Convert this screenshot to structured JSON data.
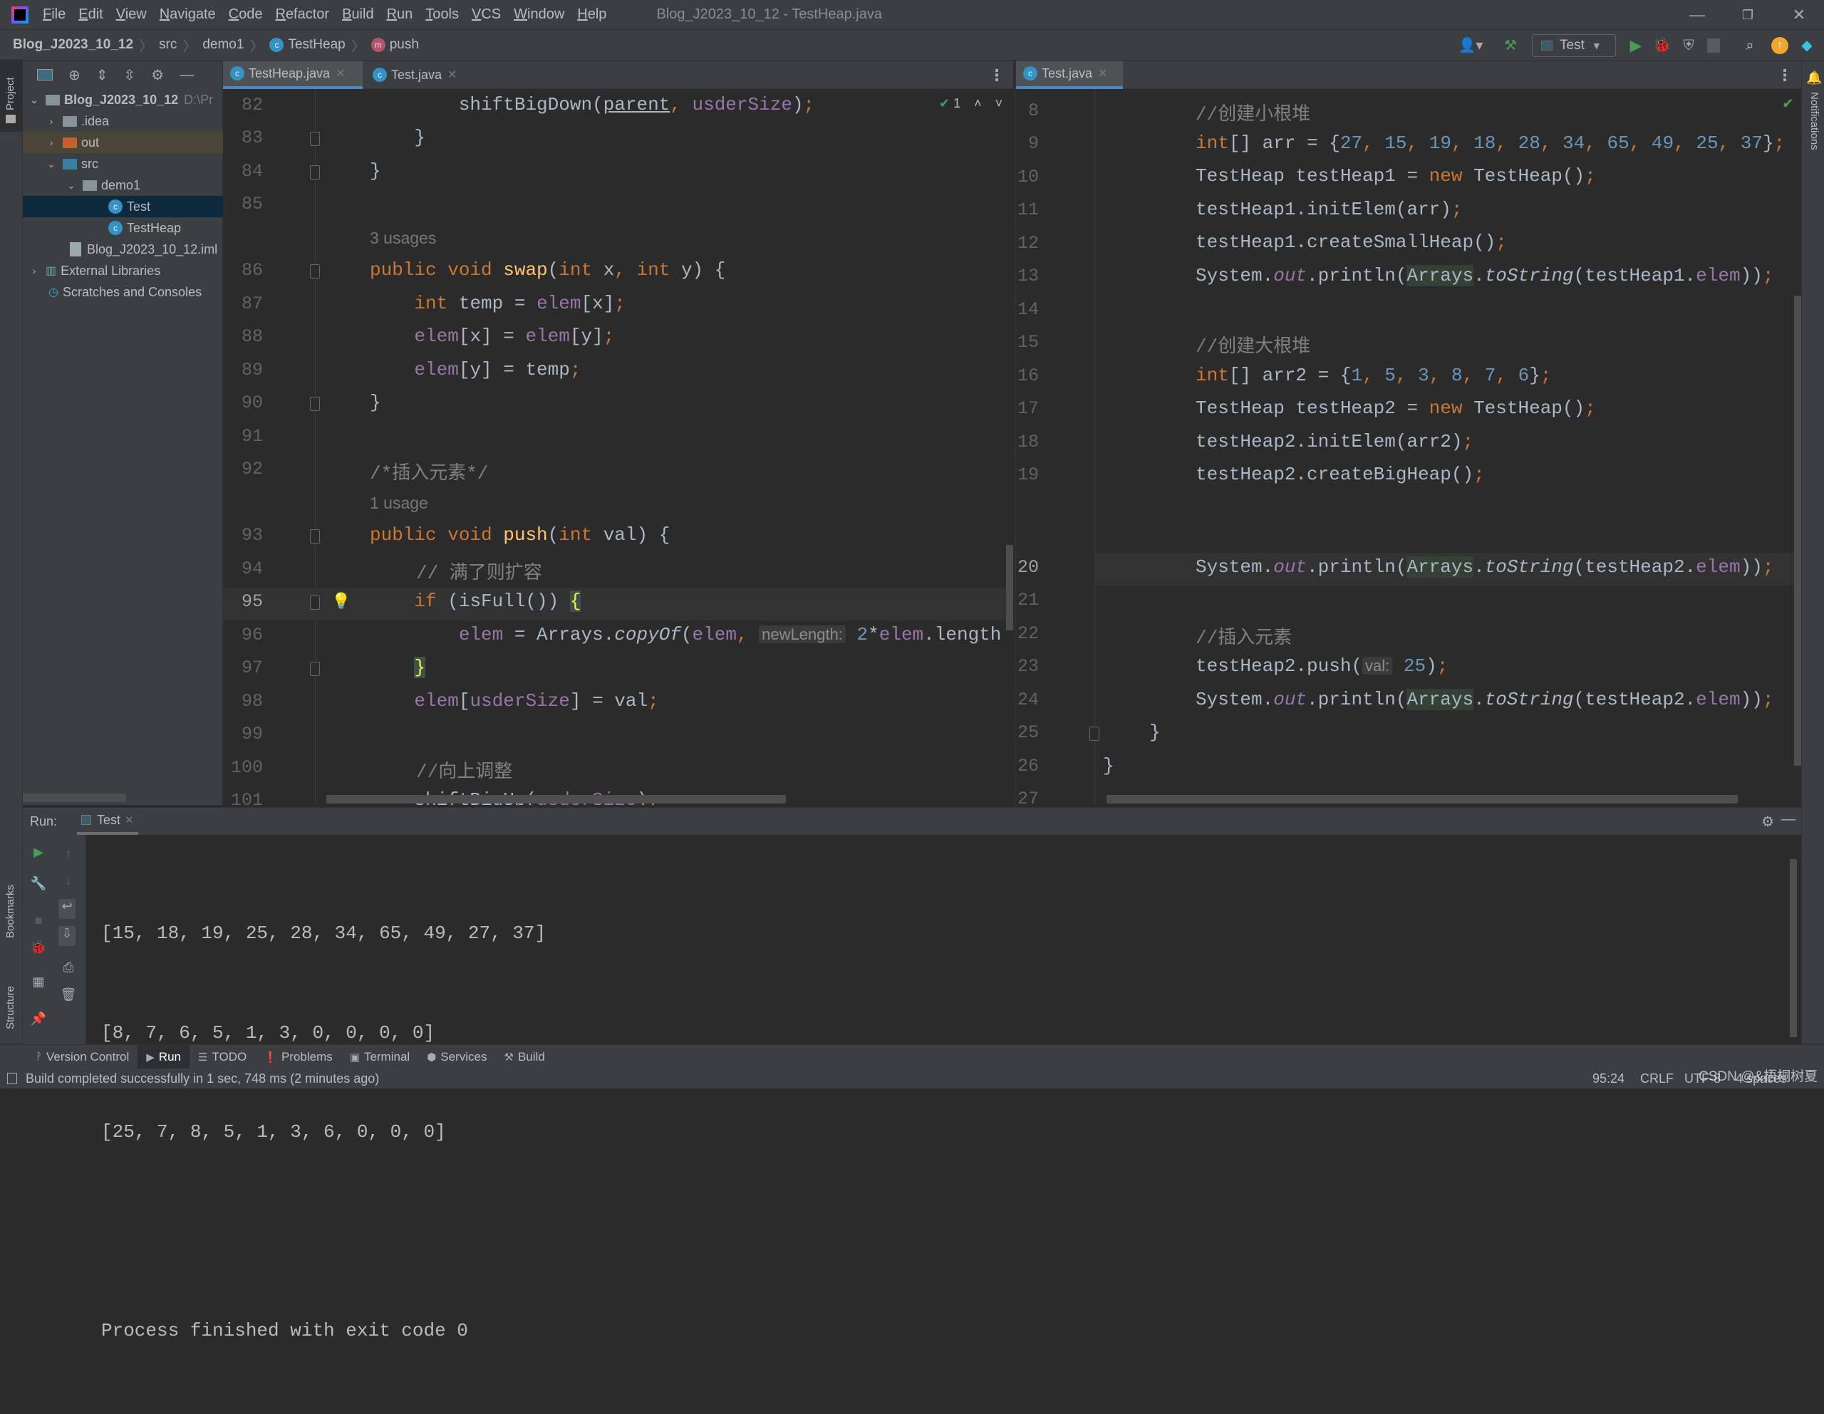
{
  "titlebar": {
    "menu": [
      "File",
      "Edit",
      "View",
      "Navigate",
      "Code",
      "Refactor",
      "Build",
      "Run",
      "Tools",
      "VCS",
      "Window",
      "Help"
    ],
    "window_title": "Blog_J2023_10_12 - TestHeap.java"
  },
  "navbar": {
    "breadcrumb": [
      "Blog_J2023_10_12",
      "src",
      "demo1",
      "TestHeap",
      "push"
    ],
    "run_config": "Test"
  },
  "left_stripe": {
    "project_label": "Project",
    "bookmarks_label": "Bookmarks",
    "structure_label": "Structure"
  },
  "right_stripe": {
    "notifications_label": "Notifications"
  },
  "project_tree": [
    {
      "label": "Blog_J2023_10_12",
      "suffix": "D:\\Pr",
      "depth": 0,
      "expanded": true,
      "type": "module"
    },
    {
      "label": ".idea",
      "depth": 1,
      "expanded": false,
      "type": "folder"
    },
    {
      "label": "out",
      "depth": 1,
      "expanded": false,
      "type": "folder-excluded"
    },
    {
      "label": "src",
      "depth": 1,
      "expanded": true,
      "type": "folder-source"
    },
    {
      "label": "demo1",
      "depth": 2,
      "expanded": true,
      "type": "package"
    },
    {
      "label": "Test",
      "depth": 3,
      "type": "class-main",
      "selected": true
    },
    {
      "label": "TestHeap",
      "depth": 3,
      "type": "class"
    },
    {
      "label": "Blog_J2023_10_12.iml",
      "depth": 1,
      "type": "iml"
    },
    {
      "label": "External Libraries",
      "depth": 0,
      "expanded": false,
      "type": "libraries"
    },
    {
      "label": "Scratches and Consoles",
      "depth": 0,
      "type": "scratches"
    }
  ],
  "editor_left": {
    "tabs": [
      {
        "label": "TestHeap.java",
        "active": true
      },
      {
        "label": "Test.java",
        "active": false
      }
    ],
    "inspection": "1",
    "current_line": 95
  },
  "editor_right": {
    "tabs": [
      {
        "label": "Test.java",
        "active": true
      }
    ],
    "current_line": 20
  },
  "left_code": {
    "l82": "82",
    "l83": "83",
    "l84": "84",
    "l85": "85",
    "l86": "86",
    "l87": "87",
    "l88": "88",
    "l89": "89",
    "l90": "90",
    "l91": "91",
    "l92": "92",
    "l93": "93",
    "l94": "94",
    "l95": "95",
    "l96": "96",
    "l97": "97",
    "l98": "98",
    "l99": "99",
    "l100": "100",
    "l101": "101",
    "usages3": "3 usages",
    "usage1": "1 usage",
    "c92": "/*插入元素*/",
    "c94": "// 满了则扩容",
    "c100": "//向上调整",
    "hint_newLength": "newLength:"
  },
  "right_code": {
    "l8": "8",
    "l9": "9",
    "l10": "10",
    "l11": "11",
    "l12": "12",
    "l13": "13",
    "l14": "14",
    "l15": "15",
    "l16": "16",
    "l17": "17",
    "l18": "18",
    "l19": "19",
    "l20": "20",
    "l21": "21",
    "l22": "22",
    "l23": "23",
    "l24": "24",
    "l25": "25",
    "l26": "26",
    "l27": "27",
    "c8": "//创建小根堆",
    "c15": "//创建大根堆",
    "c22": "//插入元素",
    "arr_values": [
      27,
      15,
      19,
      18,
      28,
      34,
      65,
      49,
      25,
      37
    ],
    "arr2_values": [
      1,
      5,
      3,
      8,
      7,
      6
    ],
    "push_hint": "val:",
    "push_value": "25"
  },
  "run_panel": {
    "label": "Run:",
    "tab": "Test",
    "output": [
      "[15, 18, 19, 25, 28, 34, 65, 49, 27, 37]",
      "[8, 7, 6, 5, 1, 3, 0, 0, 0, 0]",
      "[25, 7, 8, 5, 1, 3, 6, 0, 0, 0]",
      "",
      "Process finished with exit code 0"
    ]
  },
  "bottom_toolbar": [
    {
      "label": "Version Control",
      "icon": "vcs-icon"
    },
    {
      "label": "Run",
      "icon": "run-icon",
      "active": true
    },
    {
      "label": "TODO",
      "icon": "todo-icon"
    },
    {
      "label": "Problems",
      "icon": "problems-icon"
    },
    {
      "label": "Terminal",
      "icon": "terminal-icon"
    },
    {
      "label": "Services",
      "icon": "services-icon"
    },
    {
      "label": "Build",
      "icon": "build-icon"
    }
  ],
  "statusbar": {
    "message": "Build completed successfully in 1 sec, 748 ms (2 minutes ago)",
    "position": "95:24",
    "line_separator": "CRLF",
    "encoding": "UTF-8",
    "indent": "4 spaces",
    "watermark": "CSDN @&梧桐树夏"
  },
  "colors": {
    "keyword": "#cc7832",
    "function": "#ffc66d",
    "field": "#9876aa",
    "number": "#6897bb",
    "comment": "#808080",
    "accent": "#4a88c7",
    "run_green": "#499c54"
  }
}
